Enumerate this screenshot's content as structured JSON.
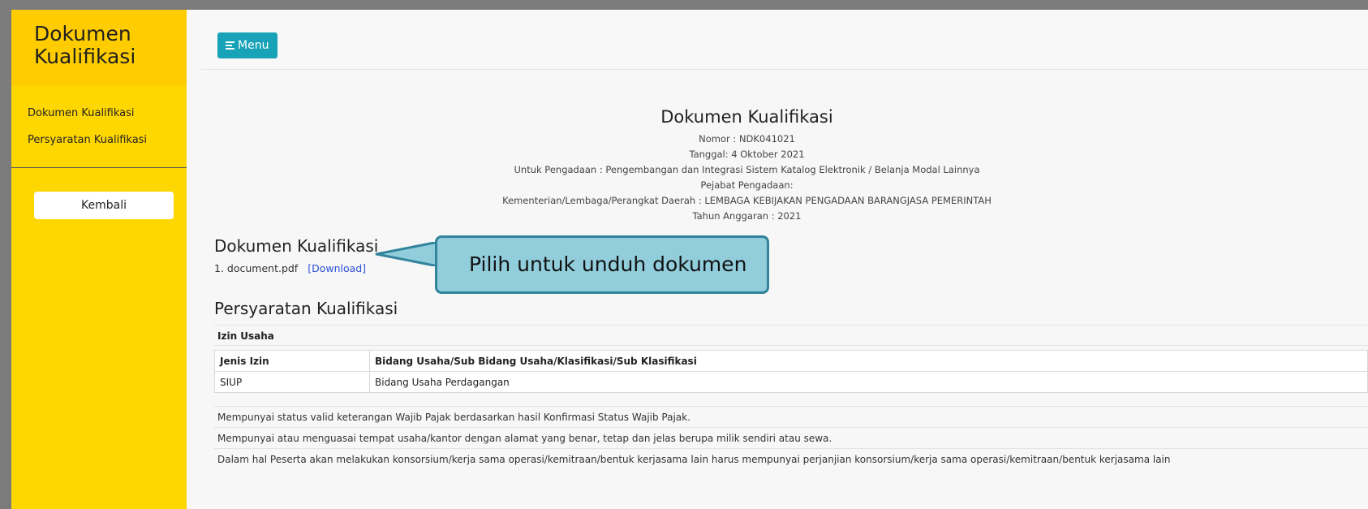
{
  "sidebar": {
    "title": "Dokumen Kualifikasi",
    "items": [
      {
        "label": "Dokumen Kualifikasi"
      },
      {
        "label": "Persyaratan Kualifikasi"
      }
    ],
    "back_label": "Kembali"
  },
  "topbar": {
    "menu_label": "Menu"
  },
  "document": {
    "title": "Dokumen Kualifikasi",
    "nomor": "Nomor : NDK041021",
    "tanggal": "Tanggal: 4 Oktober 2021",
    "pengadaan": "Untuk Pengadaan : Pengembangan dan Integrasi Sistem Katalog Elektronik / Belanja Modal Lainnya",
    "pejabat": "Pejabat Pengadaan:",
    "kementerian": "Kementerian/Lembaga/Perangkat Daerah : LEMBAGA KEBIJAKAN PENGADAAN BARANGJASA PEMERINTAH",
    "tahun": "Tahun Anggaran : 2021"
  },
  "files_section": {
    "title": "Dokumen Kualifikasi",
    "file": "1. document.pdf",
    "download_label": "[Download]"
  },
  "callout": {
    "text": "Pilih untuk unduh dokumen"
  },
  "requirements": {
    "title": "Persyaratan Kualifikasi",
    "izin_label": "Izin Usaha",
    "table": {
      "headers": [
        "Jenis Izin",
        "Bidang Usaha/Sub Bidang Usaha/Klasifikasi/Sub Klasifikasi"
      ],
      "rows": [
        [
          "SIUP",
          "Bidang Usaha Perdagangan"
        ]
      ]
    },
    "items": [
      "Mempunyai status valid keterangan Wajib Pajak berdasarkan hasil Konfirmasi Status Wajib Pajak.",
      "Mempunyai atau menguasai tempat usaha/kantor dengan alamat yang benar, tetap dan jelas berupa milik sendiri atau sewa.",
      "Dalam hal Peserta akan melakukan konsorsium/kerja sama operasi/kemitraan/bentuk kerjasama lain harus mempunyai perjanjian konsorsium/kerja sama operasi/kemitraan/bentuk kerjasama lain"
    ]
  }
}
